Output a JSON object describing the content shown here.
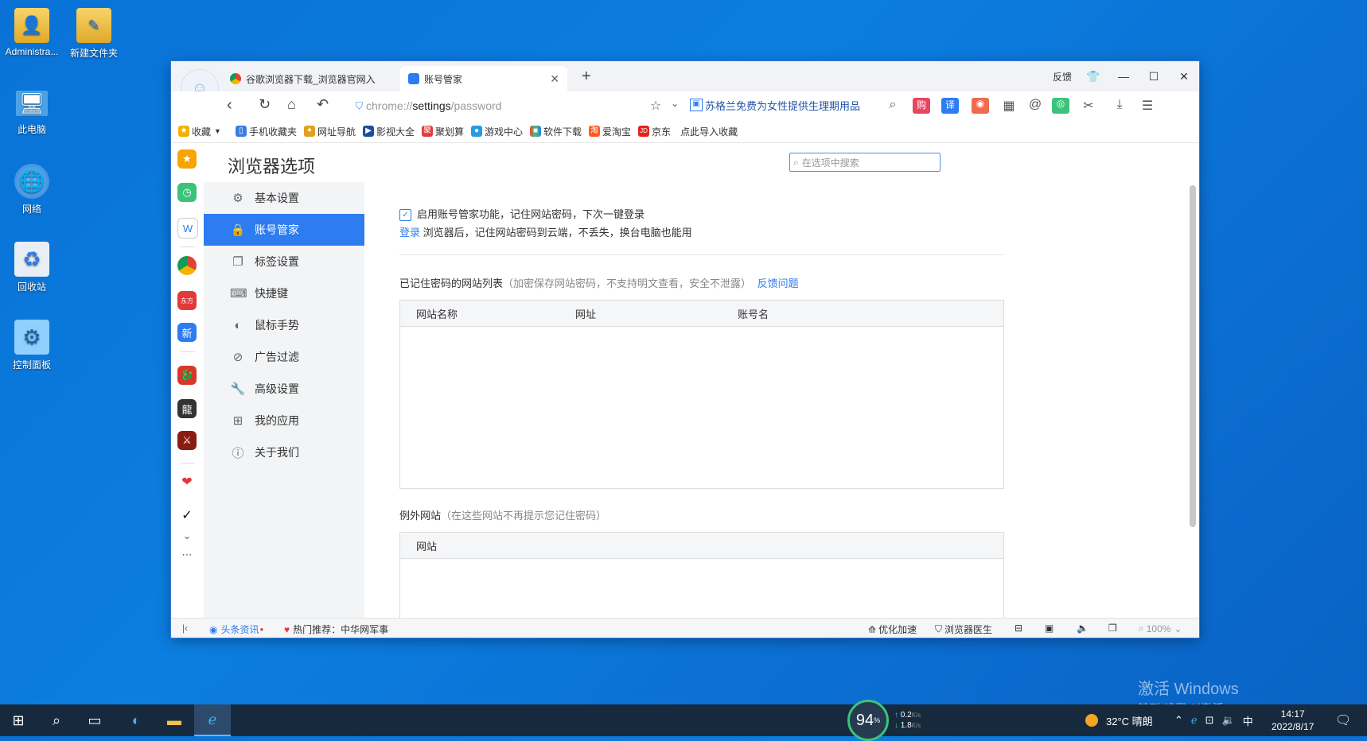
{
  "desktop": {
    "icons": [
      {
        "label": "Administra...",
        "icon": "admin-user-folder-icon"
      },
      {
        "label": "新建文件夹",
        "icon": "new-folder-icon"
      },
      {
        "label": "此电脑",
        "icon": "this-pc-icon"
      },
      {
        "label": "网络",
        "icon": "network-icon"
      },
      {
        "label": "回收站",
        "icon": "recycle-bin-icon"
      },
      {
        "label": "控制面板",
        "icon": "control-panel-icon"
      }
    ],
    "watermark_line1": "激活 Windows",
    "watermark_line2": "转到\"设置\"以激活 Windows。"
  },
  "browser": {
    "login_label": "登录",
    "tabs": [
      {
        "title": "谷歌浏览器下载_浏览器官网入",
        "active": false
      },
      {
        "title": "账号管家",
        "active": true
      }
    ],
    "new_tab": "+",
    "window_controls": {
      "feedback": "反馈",
      "minimize": "—",
      "maximize": "☐",
      "close": "✕"
    },
    "url_prefix": "chrome://",
    "url_bold": "settings",
    "url_suffix": "/password",
    "promo_text": "苏格兰免费为女性提供生理期用品",
    "bookmarks": [
      {
        "label": "收藏",
        "color": "#f2b100"
      },
      {
        "label": "手机收藏夹",
        "color": "#3b7de0"
      },
      {
        "label": "网址导航",
        "color": "#e0a020"
      },
      {
        "label": "影视大全",
        "color": "#1a4fa0"
      },
      {
        "label": "聚划算",
        "color": "#e23a3a"
      },
      {
        "label": "游戏中心",
        "color": "#2a9be0"
      },
      {
        "label": "软件下载",
        "color": "#e94c3d"
      },
      {
        "label": "爱淘宝",
        "color": "#ff5a1f"
      },
      {
        "label": "京东",
        "color": "#e1251b"
      },
      {
        "label": "点此导入收藏",
        "color": ""
      }
    ]
  },
  "settings": {
    "title": "浏览器选项",
    "search_placeholder": "在选项中搜索",
    "nav": [
      {
        "label": "基本设置",
        "icon": "gear-icon"
      },
      {
        "label": "账号管家",
        "icon": "lock-icon",
        "active": true
      },
      {
        "label": "标签设置",
        "icon": "tab-icon"
      },
      {
        "label": "快捷键",
        "icon": "keyboard-icon"
      },
      {
        "label": "鼠标手势",
        "icon": "mouse-icon"
      },
      {
        "label": "广告过滤",
        "icon": "block-icon"
      },
      {
        "label": "高级设置",
        "icon": "wrench-icon"
      },
      {
        "label": "我的应用",
        "icon": "apps-icon"
      },
      {
        "label": "关于我们",
        "icon": "info-icon"
      }
    ],
    "enable_label": "启用账号管家功能，记住网站密码，下次一键登录",
    "enable_checked": true,
    "login_link": "登录",
    "login_tail": "浏览器后，记住网站密码到云端，不丢失，换台电脑也能用",
    "saved_title": "已记住密码的网站列表",
    "saved_note": "（加密保存网站密码，不支持明文查看，安全不泄露）",
    "feedback_link": "反馈问题",
    "saved_columns": [
      "网站名称",
      "网址",
      "账号名"
    ],
    "exception_title": "例外网站",
    "exception_note": "（在这些网站不再提示您记住密码）",
    "exception_columns": [
      "网站"
    ]
  },
  "statusbar": {
    "news": "头条资讯",
    "hot": "热门推荐：中华网军事",
    "optimize": "优化加速",
    "doctor": "浏览器医生",
    "zoom": "100%"
  },
  "taskbar": {
    "cpu_percent": "94",
    "cpu_unit": "%",
    "up_speed": "0.2",
    "down_speed": "1.8",
    "speed_unit": "K/s",
    "weather": "32°C 晴朗",
    "ime": "中",
    "time": "14:17",
    "date": "2022/8/17"
  }
}
